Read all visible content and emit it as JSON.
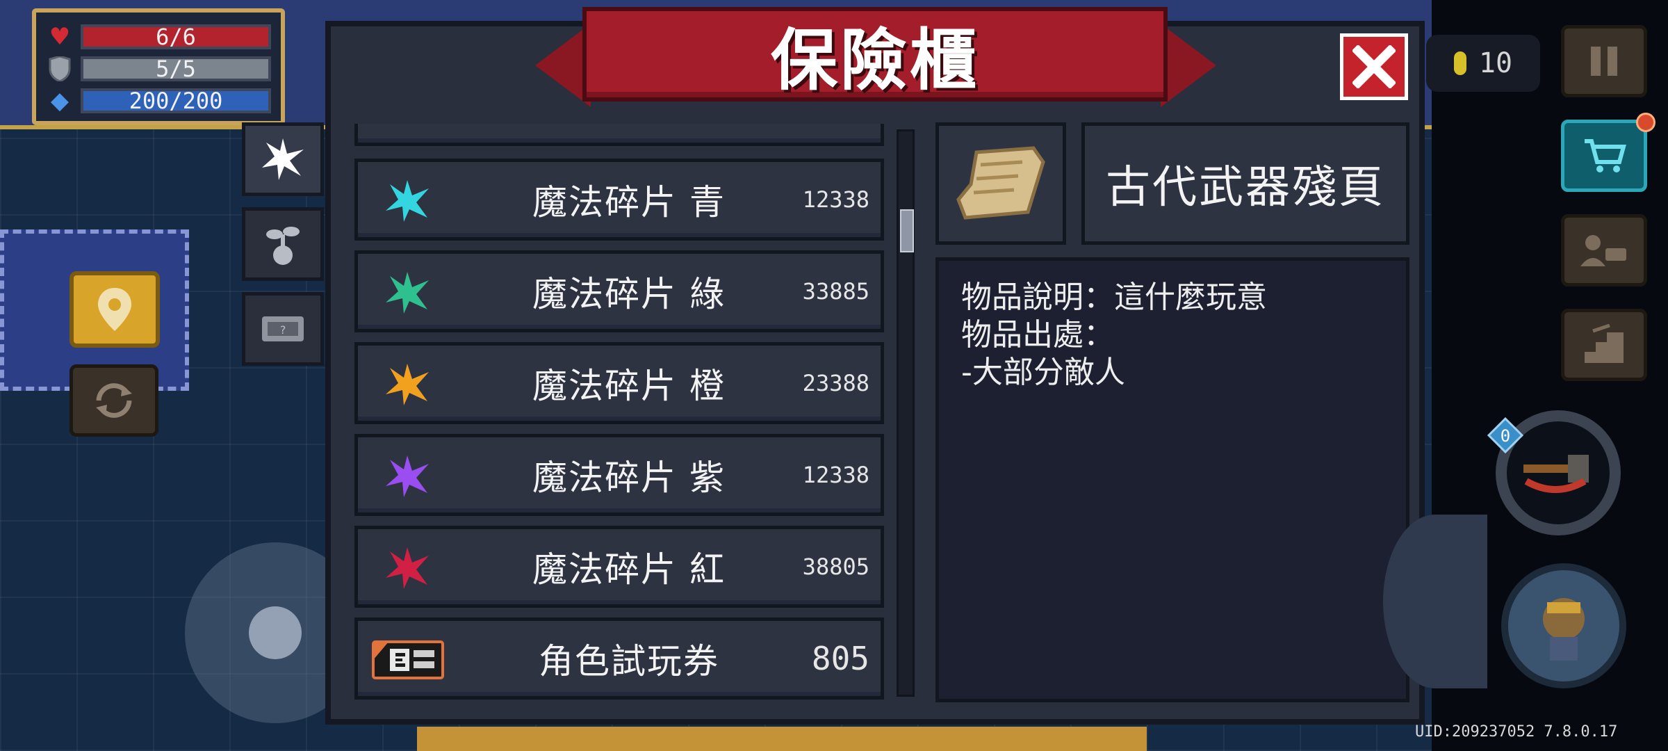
{
  "hud": {
    "hp": "6/6",
    "armor": "5/5",
    "energy": "200/200",
    "coins": "10",
    "uid_version": "UID:209237052 7.8.0.17"
  },
  "modal": {
    "title": "保險櫃"
  },
  "tabs": [
    {
      "icon": "star-burst-icon",
      "active": true
    },
    {
      "icon": "plant-icon",
      "active": false
    },
    {
      "icon": "ticket-icon",
      "active": false
    }
  ],
  "list": {
    "items": [
      {
        "name": "魔法碎片 青",
        "count": "12338",
        "icon": "crystal-cyan-icon",
        "color": "#33d6e0"
      },
      {
        "name": "魔法碎片 綠",
        "count": "33885",
        "icon": "crystal-green-icon",
        "color": "#2fc08f"
      },
      {
        "name": "魔法碎片 橙",
        "count": "23388",
        "icon": "crystal-orange-icon",
        "color": "#f2a11f"
      },
      {
        "name": "魔法碎片 紫",
        "count": "12338",
        "icon": "crystal-purple-icon",
        "color": "#9a4df0"
      },
      {
        "name": "魔法碎片 紅",
        "count": "38805",
        "icon": "crystal-red-icon",
        "color": "#d21f44"
      },
      {
        "name": "角色試玩券",
        "count": "805",
        "icon": "trial-ticket-icon",
        "color": "#e2733a"
      }
    ]
  },
  "detail": {
    "name": "古代武器殘頁",
    "description_lines": [
      "物品說明：這什麼玩意",
      "物品出處：",
      "-大部分敵人"
    ],
    "icon": "ancient-page-icon"
  },
  "colors": {
    "banner": "#a31d2a",
    "close": "#c4232c",
    "panel": "#2a2f3e"
  }
}
